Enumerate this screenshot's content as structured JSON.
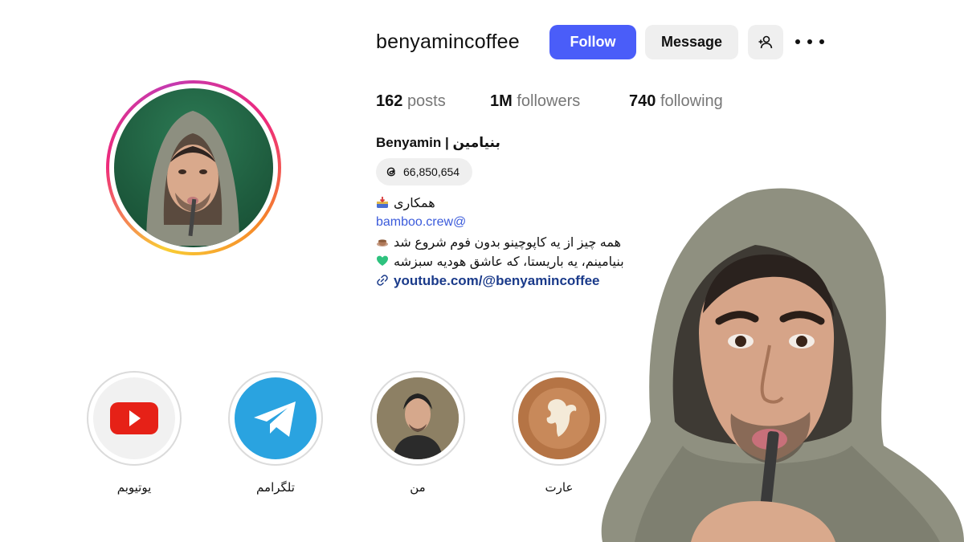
{
  "profile": {
    "username": "benyamincoffee",
    "follow_label": "Follow",
    "message_label": "Message",
    "fullname": "Benyamin | بنیامین",
    "threads_count": "66,850,654"
  },
  "stats": {
    "posts_count": "162",
    "posts_label": "posts",
    "followers_count": "1M",
    "followers_label": "followers",
    "following_count": "740",
    "following_label": "following"
  },
  "bio": {
    "line1": "همکاری",
    "line2": "bamboo.crew@",
    "line3": "همه چیز از یه کاپوچینو بدون فوم شروع شد",
    "line4": "بنیامینم، یه باریستا، که عاشق هودیه سبزشه",
    "link": "youtube.com/@benyamincoffee"
  },
  "highlights": [
    {
      "label": "یوتیوبم",
      "icon": "youtube-icon"
    },
    {
      "label": "تلگرامم",
      "icon": "telegram-icon"
    },
    {
      "label": "من",
      "icon": "portrait"
    },
    {
      "label": "عارت",
      "icon": "latte-art"
    }
  ],
  "colors": {
    "follow_button": "#4a5df9",
    "secondary_button": "#efefef",
    "youtube_red": "#e62117",
    "telegram_blue": "#2aa3e0",
    "link": "#1a3a8a"
  }
}
